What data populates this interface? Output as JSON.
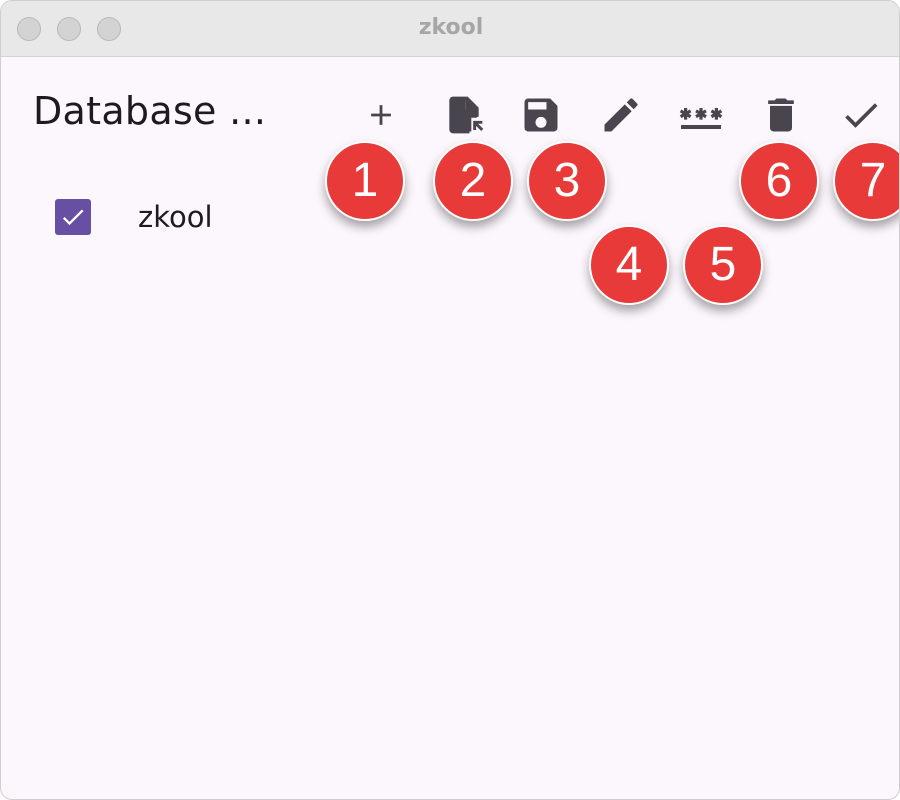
{
  "window": {
    "title": "zkool"
  },
  "header": {
    "title": "Database ..."
  },
  "toolbar": {
    "items": [
      {
        "icon": "plus-icon",
        "badge": "1"
      },
      {
        "icon": "file-import-icon",
        "badge": "2"
      },
      {
        "icon": "floppy-save-icon",
        "badge": "3"
      },
      {
        "icon": "pencil-edit-icon",
        "badge": "4"
      },
      {
        "icon": "password-asterisks-icon",
        "badge": "5"
      },
      {
        "icon": "trash-icon",
        "badge": "6"
      },
      {
        "icon": "check-icon",
        "badge": "7"
      }
    ]
  },
  "databases": [
    {
      "name": "zkool",
      "checked": true
    }
  ],
  "colors": {
    "accent": "#6750a4",
    "badge": "#e93a3a",
    "background": "#fcf7fd",
    "icon": "#49454f"
  }
}
